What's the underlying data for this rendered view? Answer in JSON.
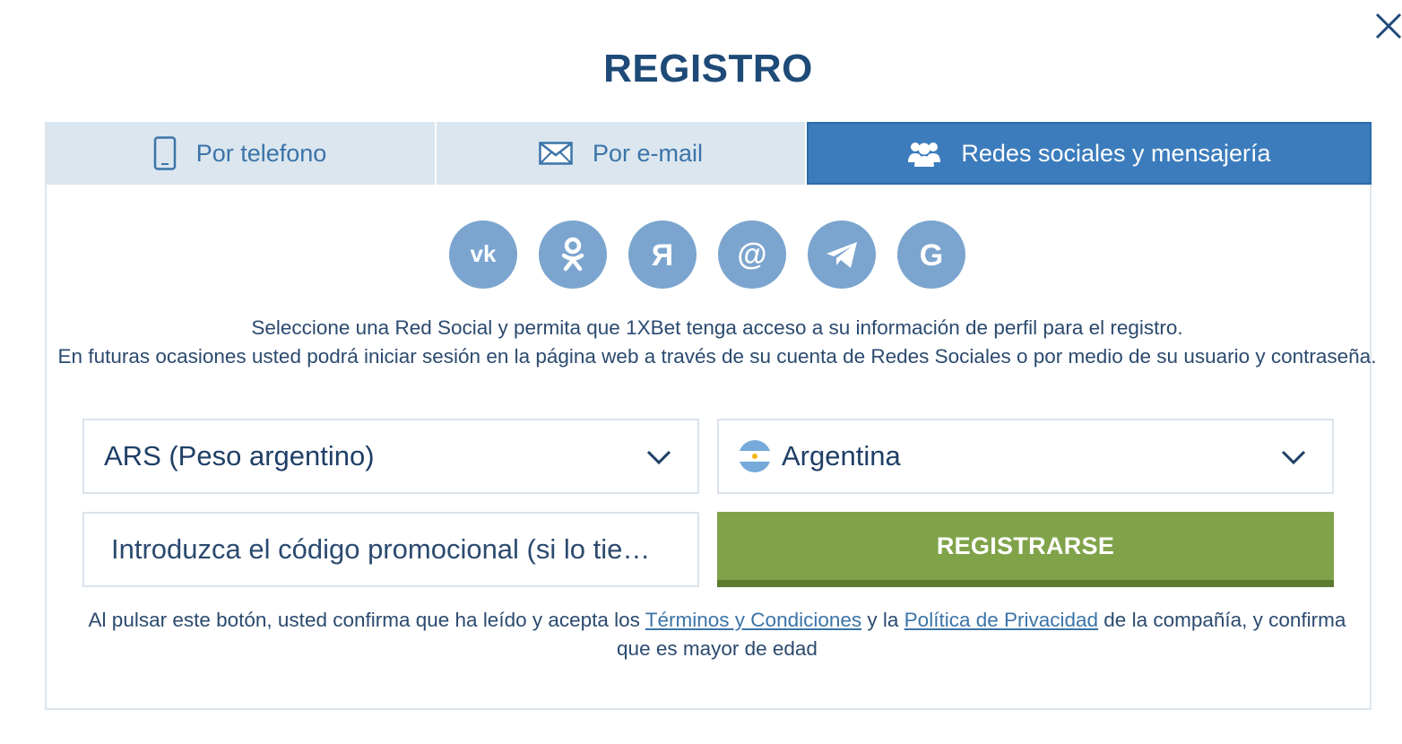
{
  "modal": {
    "title": "REGISTRO",
    "close_icon": "close-icon"
  },
  "tabs": [
    {
      "label": "Por telefono",
      "icon": "phone-icon",
      "active": false
    },
    {
      "label": "Por e-mail",
      "icon": "envelope-icon",
      "active": false
    },
    {
      "label": "Redes sociales y mensajería",
      "icon": "users-icon",
      "active": true
    }
  ],
  "social_networks": [
    {
      "name": "VK",
      "icon": "vk-icon"
    },
    {
      "name": "Odnoklassniki",
      "icon": "odnoklassniki-icon"
    },
    {
      "name": "Yandex",
      "icon": "yandex-icon"
    },
    {
      "name": "Mail.ru",
      "icon": "mail-at-icon"
    },
    {
      "name": "Telegram",
      "icon": "telegram-icon"
    },
    {
      "name": "Google",
      "icon": "google-icon"
    }
  ],
  "info": {
    "line1": "Seleccione una Red Social y permita que 1XBet tenga acceso a su información de perfil para el registro.",
    "line2": "En futuras ocasiones usted podrá iniciar sesión en la página web a través de su cuenta de Redes Sociales o por medio de su usuario y contraseña."
  },
  "form": {
    "currency_value": "ARS (Peso argentino)",
    "country_value": "Argentina",
    "country_flag": "argentina-flag-icon",
    "promo_placeholder": "Introduzca el código promocional (si lo tie…",
    "register_label": "REGISTRARSE"
  },
  "terms": {
    "prefix": "Al pulsar este botón, usted confirma que ha leído y acepta los ",
    "terms_link": "Términos y Condiciones",
    "middle": " y la ",
    "privacy_link": "Política de Privacidad",
    "suffix": " de la compañía, y confirma que es mayor de edad"
  },
  "colors": {
    "title": "#1e4a78",
    "tab_inactive_bg": "#dbe6ef",
    "tab_active_bg": "#3c7cbc",
    "social_icon_bg": "#7ba5cf",
    "register_button": "#80a34a",
    "link": "#3b74a8"
  }
}
